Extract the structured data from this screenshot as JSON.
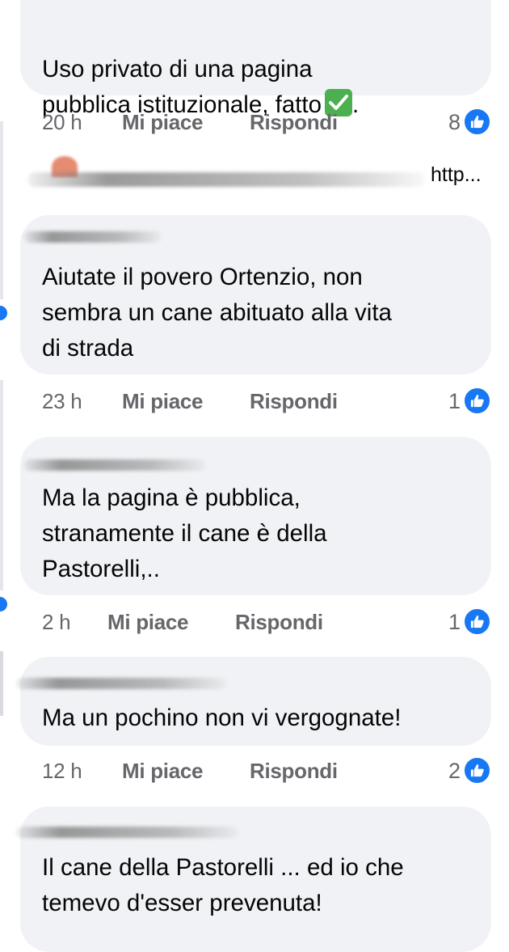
{
  "comments": [
    {
      "text": "Uso privato di una pagina\npubblica istituzionale, fatto",
      "trailing": ".",
      "emoji": "check-mark-button",
      "time": "20 h",
      "like_label": "Mi piace",
      "reply_label": "Rispondi",
      "likes": "8"
    },
    {
      "text": "Aiutate il povero Ortenzio, non\nsembra un cane abituato alla vita\ndi strada",
      "time": "23 h",
      "like_label": "Mi piace",
      "reply_label": "Rispondi",
      "likes": "1"
    },
    {
      "text": "Ma la pagina è pubblica,\nstranamente il cane è della\nPastorelli,..",
      "time": "2 h",
      "like_label": "Mi piace",
      "reply_label": "Rispondi",
      "likes": "1"
    },
    {
      "text": "Ma un pochino non vi vergognate!",
      "time": "12 h",
      "like_label": "Mi piace",
      "reply_label": "Rispondi",
      "likes": "2"
    },
    {
      "text": "Il cane della Pastorelli ... ed io che\ntemevo d'esser prevenuta!"
    }
  ],
  "reply_preview": {
    "snippet": "http..."
  },
  "colors": {
    "bubble": "#f0f2f5",
    "meta": "#65676b",
    "like_blue": "#1877f2",
    "check_green": "#4caf50"
  },
  "icons": {
    "like": "thumbs-up-icon",
    "emoji": "check-mark-emoji-icon"
  }
}
